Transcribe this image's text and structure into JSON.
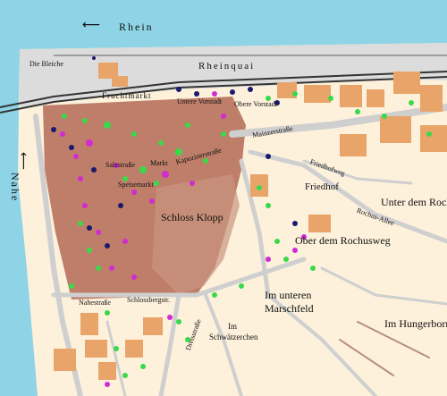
{
  "river_labels": {
    "rhein": "Rhein",
    "nahe": "Nahe"
  },
  "streets": {
    "rheinquai": "Rheinquai",
    "fruchtmarkt": "Fruchtmarkt",
    "untere_vorstadt": "Untere Vorstadt",
    "obere_vorstadt": "Obere Vorstadt",
    "mainzerstrasse": "Mainzerstraße",
    "friedhofweg": "Friedhofweg",
    "rochus_allee": "Rochus-Allee",
    "nahestrasse": "Nahestraße",
    "schlossbergstr": "Schlossbergstr.",
    "kapuzinerstrasse": "Kapuzinerstraße",
    "markt": "Markt",
    "salzstrasse": "Salzstraße",
    "speisemarkt": "Speisemarkt",
    "dreisstrasse": "Dreisstraße"
  },
  "areas": {
    "die_bleiche": "Die Bleiche",
    "schloss_klopp": "Schloss Klopp",
    "friedhof": "Friedhof",
    "unter_dem_rochus": "Unter dem Roch",
    "ober_dem_rochusweg": "Ober dem Rochusweg",
    "im_unteren_marschfeld": "Im unteren\nMarschfeld",
    "im_unteren_1": "Im unteren",
    "im_unteren_2": "Marschfeld",
    "im_schwaetzerchen_1": "Im",
    "im_schwaetzerchen_2": "Schwätzerchen",
    "im_hungerborn": "Im Hungerborn"
  },
  "colors": {
    "water": "#8ed4e6",
    "land": "#fdf1dc",
    "quay": "#d9d9d9",
    "building": "#e9a46a",
    "street": "#cfcfcf",
    "old_town": "#b36a55",
    "marker_green": "#39d94a",
    "marker_magenta": "#d12bd1",
    "marker_navy": "#1a1a6e"
  }
}
